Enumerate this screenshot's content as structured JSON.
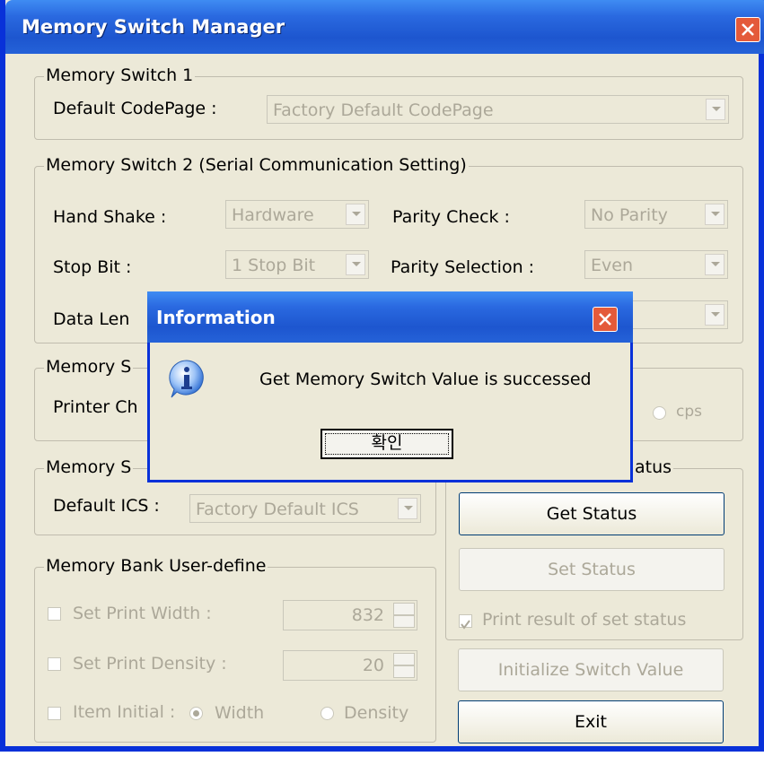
{
  "window": {
    "title": "Memory Switch Manager",
    "close_icon": "close-icon"
  },
  "ms1": {
    "title": "Memory Switch 1",
    "codepage_label": "Default CodePage  :",
    "codepage_value": "Factory Default CodePage"
  },
  "ms2": {
    "title": "Memory Switch 2 (Serial Communication Setting)",
    "handshake_label": "Hand Shake :",
    "handshake_value": "Hardware",
    "parity_check_label": "Parity Check :",
    "parity_check_value": "No Parity",
    "stopbit_label": "Stop Bit :",
    "stopbit_value": "1 Stop Bit",
    "parity_sel_label": "Parity Selection :",
    "parity_sel_value": "Even",
    "datalen_label": "Data Len"
  },
  "ms3": {
    "title": "Memory S",
    "printer_label": "Printer Ch",
    "cps_label": "cps"
  },
  "ms4": {
    "title": "Memory S",
    "ics_label": "Default ICS :",
    "ics_value": "Factory Default ICS"
  },
  "status": {
    "title": "atus",
    "get_label": "Get Status",
    "set_label": "Set Status",
    "print_result_label": "Print result of set status"
  },
  "bank": {
    "title": "Memory Bank User-define",
    "width_label": "Set Print Width :",
    "width_value": "832",
    "density_label": "Set Print Density :",
    "density_value": "20",
    "item_initial_label": "Item Initial :",
    "width_radio": "Width",
    "density_radio": "Density"
  },
  "buttons": {
    "init_label": "Initialize Switch Value",
    "exit_label": "Exit"
  },
  "dialog": {
    "title": "Information",
    "message": "Get Memory Switch Value is successed",
    "ok_label": "확인"
  }
}
